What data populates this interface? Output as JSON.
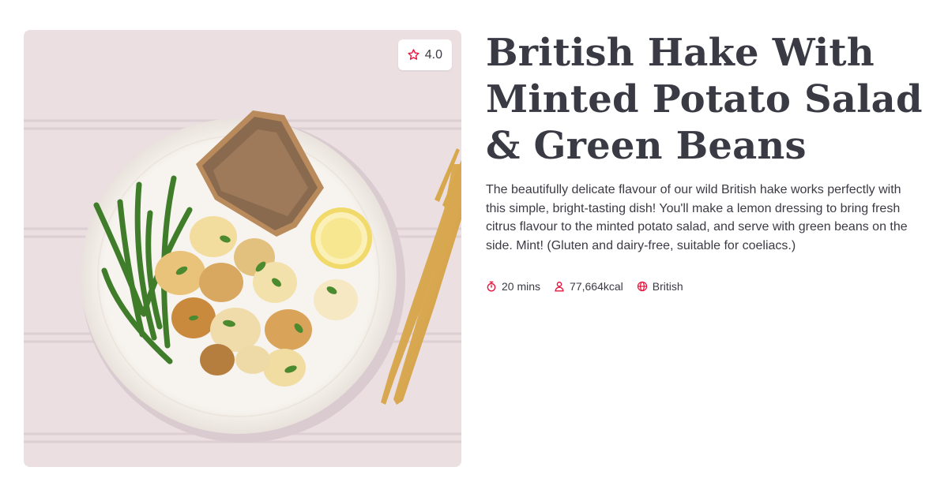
{
  "recipe": {
    "title": "British Hake With Minted Potato Salad & Green Beans",
    "description": "The beautifully delicate flavour of our wild British hake works perfectly with this simple, bright-tasting dish! You'll make a lemon dressing to bring fresh citrus flavour to the minted potato salad, and serve with green beans on the side. Mint! (Gluten and dairy-free, suitable for coeliacs.)",
    "rating": "4.0",
    "rating_icon": "star-icon",
    "meta": {
      "time": "20 mins",
      "time_icon": "timer-icon",
      "calories": "77,664kcal",
      "calories_icon": "person-icon",
      "cuisine": "British",
      "cuisine_icon": "globe-icon"
    }
  },
  "colors": {
    "accent": "#e8173f",
    "text": "#3b3b45",
    "photo_background": "#ebdfe2"
  }
}
